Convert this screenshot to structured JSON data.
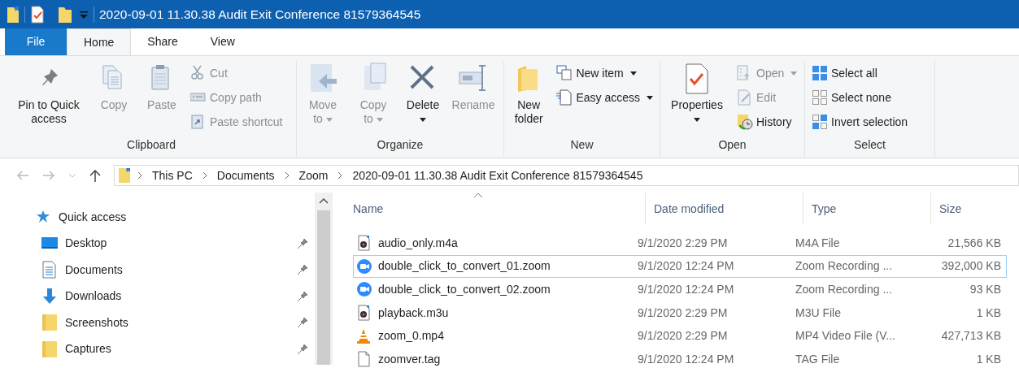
{
  "window": {
    "title": "2020-09-01 11.30.38 Audit Exit Conference 81579364545"
  },
  "tabs": [
    {
      "label": "File",
      "kind": "file",
      "selected": false
    },
    {
      "label": "Home",
      "kind": "tab",
      "selected": true
    },
    {
      "label": "Share",
      "kind": "tab",
      "selected": false
    },
    {
      "label": "View",
      "kind": "tab",
      "selected": false
    }
  ],
  "ribbon": {
    "groups": [
      {
        "label": "Clipboard",
        "items": [
          {
            "kind": "large",
            "label": "Pin to Quick access",
            "disabled": false,
            "dropdown": false
          },
          {
            "kind": "large",
            "label": "Copy",
            "disabled": true,
            "dropdown": false
          },
          {
            "kind": "large",
            "label": "Paste",
            "disabled": true,
            "dropdown": false
          },
          {
            "kind": "small",
            "label": "Cut",
            "disabled": true,
            "dropdown": false
          },
          {
            "kind": "small",
            "label": "Copy path",
            "disabled": true,
            "dropdown": false
          },
          {
            "kind": "small",
            "label": "Paste shortcut",
            "disabled": true,
            "dropdown": false
          }
        ]
      },
      {
        "label": "Organize",
        "items": [
          {
            "kind": "large",
            "label": "Move to",
            "disabled": true,
            "dropdown": true
          },
          {
            "kind": "large",
            "label": "Copy to",
            "disabled": true,
            "dropdown": true
          },
          {
            "kind": "large",
            "label": "Delete",
            "disabled": false,
            "dropdown": true
          },
          {
            "kind": "large",
            "label": "Rename",
            "disabled": true,
            "dropdown": false
          }
        ]
      },
      {
        "label": "New",
        "items": [
          {
            "kind": "large",
            "label": "New folder",
            "disabled": false,
            "dropdown": false
          },
          {
            "kind": "small",
            "label": "New item",
            "disabled": false,
            "dropdown": true
          },
          {
            "kind": "small",
            "label": "Easy access",
            "disabled": false,
            "dropdown": true
          }
        ]
      },
      {
        "label": "Open",
        "items": [
          {
            "kind": "large",
            "label": "Properties",
            "disabled": false,
            "dropdown": true
          },
          {
            "kind": "small",
            "label": "Open",
            "disabled": true,
            "dropdown": true
          },
          {
            "kind": "small",
            "label": "Edit",
            "disabled": true,
            "dropdown": false
          },
          {
            "kind": "small",
            "label": "History",
            "disabled": false,
            "dropdown": false
          }
        ]
      },
      {
        "label": "Select",
        "items": [
          {
            "kind": "small",
            "label": "Select all",
            "disabled": false,
            "dropdown": false
          },
          {
            "kind": "small",
            "label": "Select none",
            "disabled": false,
            "dropdown": false
          },
          {
            "kind": "small",
            "label": "Invert selection",
            "disabled": false,
            "dropdown": false
          }
        ]
      }
    ]
  },
  "address_bar": {
    "path": [
      "This PC",
      "Documents",
      "Zoom",
      "2020-09-01 11.30.38 Audit Exit Conference 81579364545"
    ]
  },
  "navigation_pane": {
    "items": [
      {
        "label": "Quick access",
        "kind": "header",
        "pinned": false
      },
      {
        "label": "Desktop",
        "kind": "item",
        "pinned": true
      },
      {
        "label": "Documents",
        "kind": "item",
        "pinned": true
      },
      {
        "label": "Downloads",
        "kind": "item",
        "pinned": true
      },
      {
        "label": "Screenshots",
        "kind": "item",
        "pinned": true
      },
      {
        "label": "Captures",
        "kind": "item",
        "pinned": true
      }
    ]
  },
  "file_list": {
    "columns": [
      "Name",
      "Date modified",
      "Type",
      "Size"
    ],
    "rows": [
      {
        "name": "audio_only.m4a",
        "kind": "media",
        "date": "9/1/2020 2:29 PM",
        "type": "M4A File",
        "size": "21,566 KB",
        "focused": false
      },
      {
        "name": "double_click_to_convert_01.zoom",
        "kind": "zoom",
        "date": "9/1/2020 12:24 PM",
        "type": "Zoom Recording ...",
        "size": "392,000 KB",
        "focused": true
      },
      {
        "name": "double_click_to_convert_02.zoom",
        "kind": "zoom",
        "date": "9/1/2020 12:24 PM",
        "type": "Zoom Recording ...",
        "size": "93 KB",
        "focused": false
      },
      {
        "name": "playback.m3u",
        "kind": "media",
        "date": "9/1/2020 2:29 PM",
        "type": "M3U File",
        "size": "1 KB",
        "focused": false
      },
      {
        "name": "zoom_0.mp4",
        "kind": "cone",
        "date": "9/1/2020 2:29 PM",
        "type": "MP4 Video File (V...",
        "size": "427,713 KB",
        "focused": false
      },
      {
        "name": "zoomver.tag",
        "kind": "doc",
        "date": "9/1/2020 12:24 PM",
        "type": "TAG File",
        "size": "1 KB",
        "focused": false
      }
    ]
  }
}
